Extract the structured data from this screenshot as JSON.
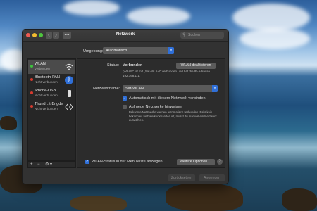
{
  "window": {
    "title": "Netzwerk",
    "search_placeholder": "Suchen",
    "back": "‹",
    "forward": "›",
    "grid": "⋯"
  },
  "location": {
    "label": "Umgebung:",
    "value": "Automatisch"
  },
  "services": [
    {
      "name": "WLAN",
      "status": "Verbunden",
      "dot": "#3ec23e",
      "icon": "wifi-icon",
      "glyph": "◠"
    },
    {
      "name": "Bluetooth-PAN",
      "status": "Nicht verbunden",
      "dot": "#d63b2f",
      "icon": "bluetooth-icon",
      "glyph": "ᛒ"
    },
    {
      "name": "iPhone-USB",
      "status": "Nicht verbunden",
      "dot": "#d63b2f",
      "icon": "phone-icon",
      "glyph": "▯"
    },
    {
      "name": "Thund…t-Brigde",
      "status": "Nicht verbunden",
      "dot": "#d63b2f",
      "icon": "thunderbolt-bridge-icon",
      "glyph": "⟨⟩"
    }
  ],
  "sidebar_tools": {
    "add": "+",
    "remove": "−",
    "gear": "⚙ ▾"
  },
  "status": {
    "label": "Status:",
    "value": "Verbunden",
    "button": "WLAN deaktivieren",
    "description_line1": "„WLAN“ ist mit „Sat-WLAN“ verbunden und hat die IP-Adresse",
    "description_line2": "192.168.1.1."
  },
  "network_name": {
    "label": "Netzwerkname:",
    "value": "Sat-WLAN"
  },
  "auto_join": {
    "label": "Automatisch mit diesem Netzwerk verbinden",
    "checked": true
  },
  "ask_new": {
    "label": "Auf neue Netzwerke hinweisen",
    "checked": false,
    "note_line1": "Bekannte Netzwerke werden automatisch verbunden. Falls kein",
    "note_line2": "bekanntes Netzwerk vorhanden ist, musst du manuell ein Netzwerk",
    "note_line3": "auswählen."
  },
  "menubar_status": {
    "label": "WLAN-Status in der Menüleiste anzeigen",
    "checked": true
  },
  "advanced_button": "Weitere Optionen …",
  "help": "?",
  "footer": {
    "revert": "Zurücksetzen",
    "apply": "Anwenden"
  },
  "colors": {
    "accent": "#2f6fd8",
    "connected": "#3ec23e",
    "disconnected": "#d63b2f"
  }
}
